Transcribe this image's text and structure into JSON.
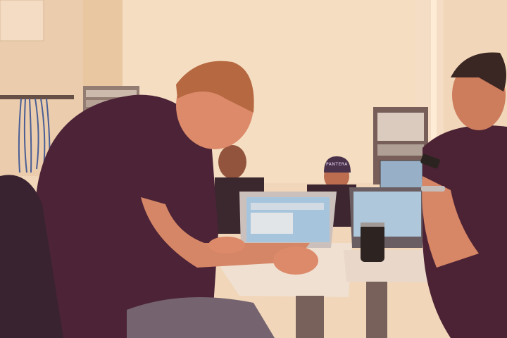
{
  "scene": {
    "beanie_text": "PANTERA"
  },
  "colors": {
    "wall": "#f0dcc0",
    "wall_shadow": "#d9b48f",
    "shirt_purple": "#3d1a33",
    "skin": "#d9896b",
    "screen": "#9fc9e6",
    "desk": "#efe6dc"
  }
}
